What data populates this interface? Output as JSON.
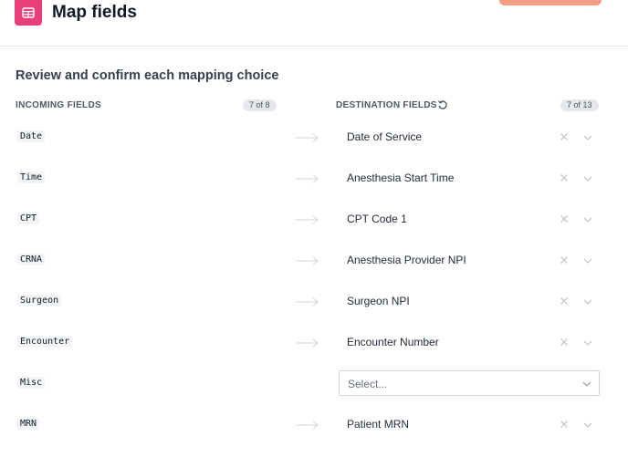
{
  "header": {
    "title": "Map fields",
    "app_icon": "table-icon",
    "accent_color": "#ea3e7a"
  },
  "main": {
    "subtitle": "Review and confirm each mapping choice",
    "incoming": {
      "label": "INCOMING FIELDS",
      "count": "7 of 8"
    },
    "destination": {
      "label": "DESTINATION FIELDS",
      "count": "7 of 13",
      "reset_icon": "reset-icon"
    },
    "select_placeholder": "Select...",
    "rows": [
      {
        "incoming": "Date",
        "destination": "Date of Service"
      },
      {
        "incoming": "Time",
        "destination": "Anesthesia Start Time"
      },
      {
        "incoming": "CPT",
        "destination": "CPT Code 1"
      },
      {
        "incoming": "CRNA",
        "destination": "Anesthesia Provider NPI"
      },
      {
        "incoming": "Surgeon",
        "destination": "Surgeon NPI"
      },
      {
        "incoming": "Encounter",
        "destination": "Encounter Number"
      },
      {
        "incoming": "Misc",
        "destination": ""
      },
      {
        "incoming": "MRN",
        "destination": "Patient MRN"
      }
    ]
  }
}
